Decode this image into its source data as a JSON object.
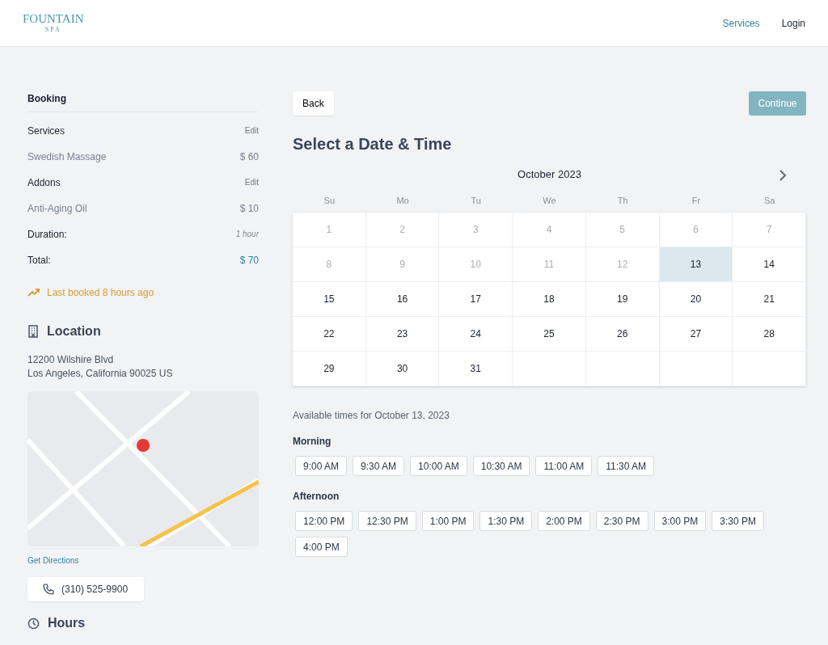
{
  "header": {
    "logo": {
      "name": "FOUNTAIN",
      "sub": "SPA"
    },
    "nav": [
      {
        "label": "Services",
        "selected": true
      },
      {
        "label": "Login",
        "selected": false
      }
    ]
  },
  "booking": {
    "title": "Booking",
    "sections": [
      {
        "label": "Services",
        "action": "Edit",
        "item": "Swedish Massage",
        "price": "$ 60"
      },
      {
        "label": "Addons",
        "action": "Edit",
        "item": "Anti-Aging Oil",
        "price": "$ 10"
      }
    ],
    "duration": {
      "label": "Duration:",
      "value": "1 hour"
    },
    "total": {
      "label": "Total:",
      "value": "$ 70"
    },
    "last_booked": "Last booked 8 hours ago"
  },
  "location": {
    "title": "Location",
    "address": [
      "12200 Wilshire Blvd",
      "Los Angeles, California 90025 US"
    ],
    "directions": "Get Directions",
    "phone": "(310) 525-9900"
  },
  "hours": {
    "title": "Hours"
  },
  "actions": {
    "back": "Back",
    "continue": {
      "label": "Continue",
      "disabled": true
    }
  },
  "calendar": {
    "title": "Select a Date & Time",
    "month": "October 2023",
    "weekdays": [
      "Su",
      "Mo",
      "Tu",
      "We",
      "Th",
      "Fr",
      "Sa"
    ],
    "days": [
      {
        "day": "1",
        "disabled": true,
        "selected": false
      },
      {
        "day": "2",
        "disabled": true,
        "selected": false
      },
      {
        "day": "3",
        "disabled": true,
        "selected": false
      },
      {
        "day": "4",
        "disabled": true,
        "selected": false
      },
      {
        "day": "5",
        "disabled": true,
        "selected": false
      },
      {
        "day": "6",
        "disabled": true,
        "selected": false
      },
      {
        "day": "7",
        "disabled": true,
        "selected": false
      },
      {
        "day": "8",
        "disabled": true,
        "selected": false
      },
      {
        "day": "9",
        "disabled": true,
        "selected": false
      },
      {
        "day": "10",
        "disabled": true,
        "selected": false
      },
      {
        "day": "11",
        "disabled": true,
        "selected": false
      },
      {
        "day": "12",
        "disabled": true,
        "selected": false
      },
      {
        "day": "13",
        "disabled": false,
        "selected": true
      },
      {
        "day": "14",
        "disabled": false,
        "selected": false
      },
      {
        "day": "15",
        "disabled": false,
        "selected": false
      },
      {
        "day": "16",
        "disabled": false,
        "selected": false
      },
      {
        "day": "17",
        "disabled": false,
        "selected": false
      },
      {
        "day": "18",
        "disabled": false,
        "selected": false
      },
      {
        "day": "19",
        "disabled": false,
        "selected": false
      },
      {
        "day": "20",
        "disabled": false,
        "selected": false
      },
      {
        "day": "21",
        "disabled": false,
        "selected": false
      },
      {
        "day": "22",
        "disabled": false,
        "selected": false
      },
      {
        "day": "23",
        "disabled": false,
        "selected": false
      },
      {
        "day": "24",
        "disabled": false,
        "selected": false
      },
      {
        "day": "25",
        "disabled": false,
        "selected": false
      },
      {
        "day": "26",
        "disabled": false,
        "selected": false
      },
      {
        "day": "27",
        "disabled": false,
        "selected": false
      },
      {
        "day": "28",
        "disabled": false,
        "selected": false
      },
      {
        "day": "29",
        "disabled": false,
        "selected": false
      },
      {
        "day": "30",
        "disabled": false,
        "selected": false
      },
      {
        "day": "31",
        "disabled": false,
        "selected": false
      }
    ]
  },
  "times": {
    "caption": "Available times for October 13, 2023",
    "groups": [
      {
        "label": "Morning",
        "slots": [
          "9:00 AM",
          "9:30 AM",
          "10:00 AM",
          "10:30 AM",
          "11:00 AM",
          "11:30 AM"
        ]
      },
      {
        "label": "Afternoon",
        "slots": [
          "12:00 PM",
          "12:30 PM",
          "1:00 PM",
          "1:30 PM",
          "2:00 PM",
          "2:30 PM",
          "3:00 PM",
          "3:30 PM",
          "4:00 PM"
        ]
      }
    ]
  }
}
